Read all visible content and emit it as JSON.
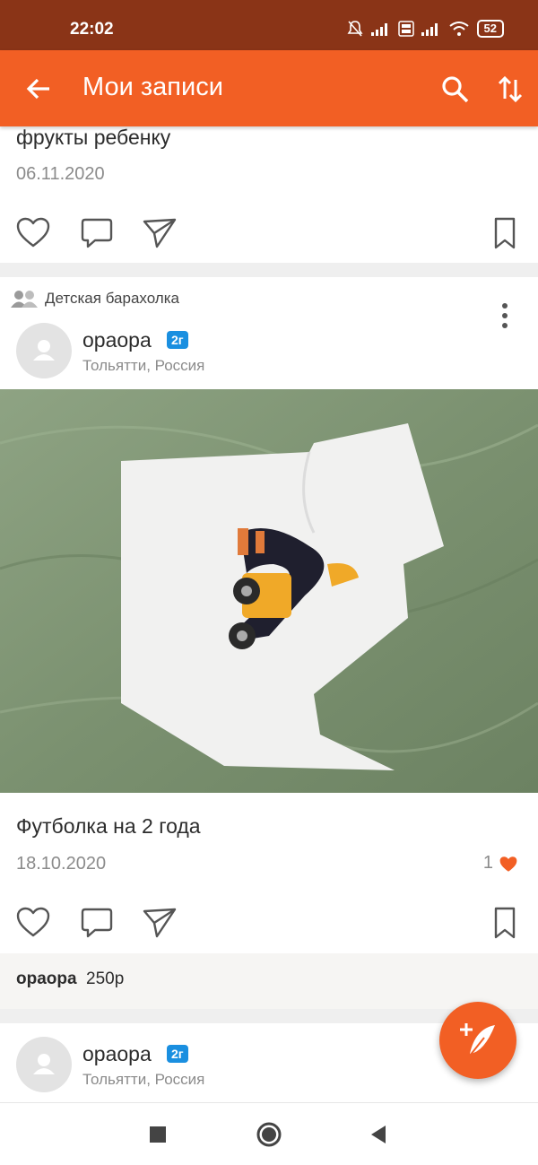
{
  "status_bar": {
    "time": "22:02",
    "battery": "52"
  },
  "app_bar": {
    "title": "Мои записи"
  },
  "post1": {
    "text": "фрукты ребенку",
    "date": "06.11.2020"
  },
  "post2": {
    "group": "Детская барахолка",
    "author": "ораора",
    "age_badge": "2г",
    "location": "Тольятти, Россия",
    "text": "Футболка на 2 года",
    "date": "18.10.2020",
    "likes": "1",
    "comment": {
      "author": "ораора",
      "text": "250р"
    }
  },
  "post3": {
    "author": "ораора",
    "age_badge": "2г",
    "location": "Тольятти, Россия"
  },
  "colors": {
    "accent": "#f25f24",
    "status_bar": "#8a3417",
    "badge": "#1a8fe0"
  }
}
